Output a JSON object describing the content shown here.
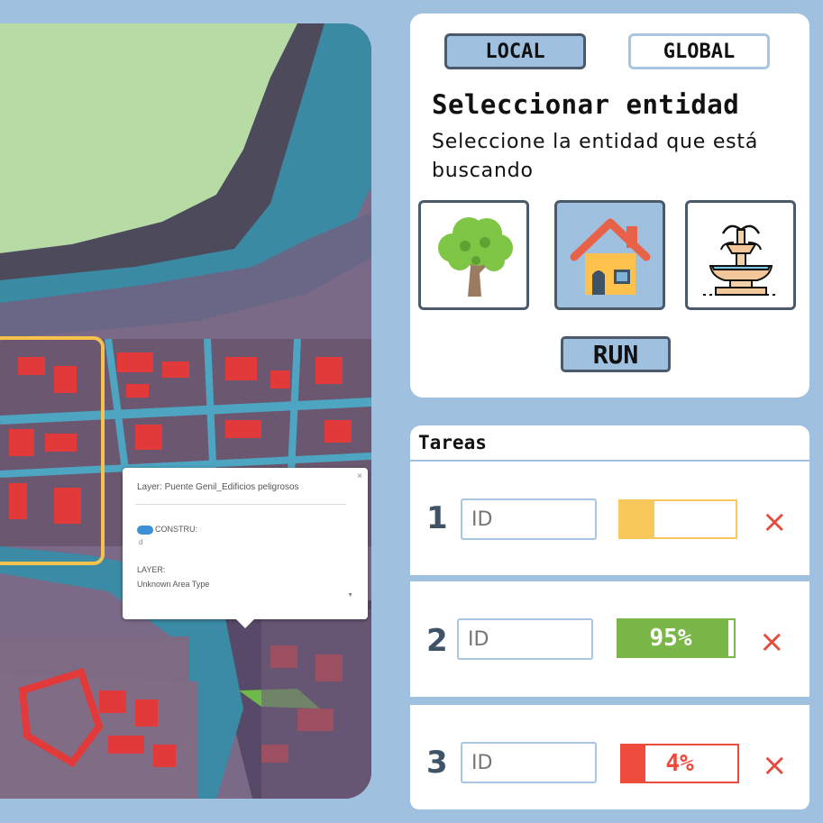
{
  "map": {
    "popup": {
      "title": "Layer: Puente Genil_Edificios peligrosos",
      "close": "×",
      "field1_label": "CONSTRU:",
      "field1_value": "d",
      "field2_label": "LAYER:",
      "field2_value": "Unknown Area Type"
    },
    "selection_color": "#f6c24c"
  },
  "panel": {
    "scope_options": [
      "LOCAL",
      "GLOBAL"
    ],
    "active_scope": "LOCAL",
    "title": "Seleccionar entidad",
    "subtitle": "Seleccione la entidad que está buscando",
    "entities": [
      {
        "icon": "tree-icon",
        "selected": false
      },
      {
        "icon": "house-icon",
        "selected": true
      },
      {
        "icon": "fountain-icon",
        "selected": false
      }
    ],
    "run_label": "RUN"
  },
  "tasks": {
    "title": "Tareas",
    "items": [
      {
        "number": "1",
        "placeholder": "ID",
        "progress": 0.3,
        "progress_label": "30%",
        "color": "#f8c95a",
        "delete": "×"
      },
      {
        "number": "2",
        "placeholder": "ID",
        "progress": 0.95,
        "progress_label": "95%",
        "color": "#7ab648",
        "delete": "×"
      },
      {
        "number": "3",
        "placeholder": "ID",
        "progress": 0.04,
        "progress_label": "4%",
        "color": "#ef4b3c",
        "delete": "×"
      }
    ]
  },
  "colors": {
    "background": "#9fc1df",
    "accent_border": "#4a5a6a",
    "delete": "#e54a3c"
  }
}
